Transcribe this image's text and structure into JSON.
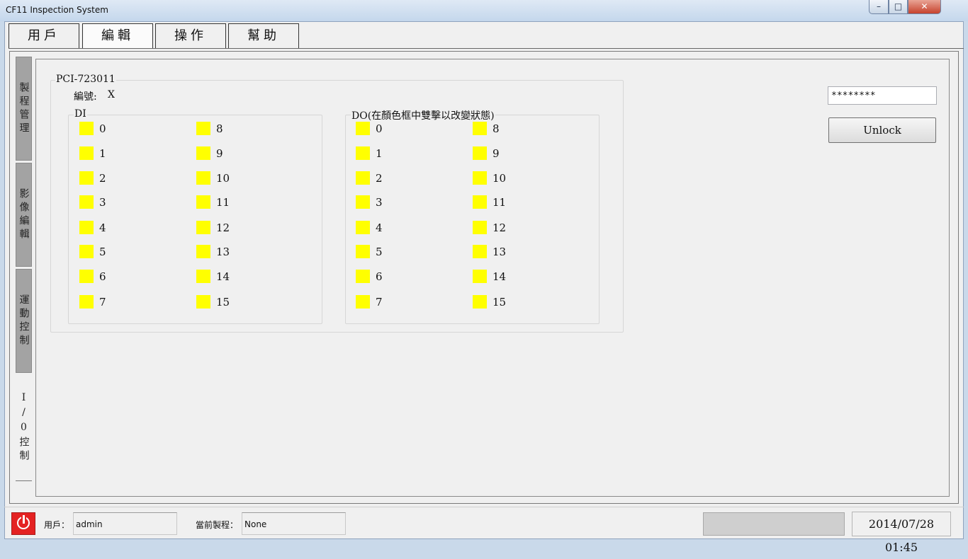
{
  "window": {
    "title": "CF11 Inspection System",
    "controls": {
      "min": "–",
      "max": "□",
      "close": "✕"
    }
  },
  "menu": [
    {
      "label": "用戶"
    },
    {
      "label": "編輯"
    },
    {
      "label": "操作"
    },
    {
      "label": "幫助"
    }
  ],
  "side_tabs": [
    {
      "label": "製程管理"
    },
    {
      "label": "影像編輯"
    },
    {
      "label": "運動控制"
    },
    {
      "label": "I/0控制"
    }
  ],
  "io": {
    "card": "PCI-723011",
    "id_label": "編號:",
    "id_value": "X",
    "di": {
      "title": "DI",
      "channels": [
        "0",
        "1",
        "2",
        "3",
        "4",
        "5",
        "6",
        "7",
        "8",
        "9",
        "10",
        "11",
        "12",
        "13",
        "14",
        "15"
      ],
      "indicator_color": "#ffff00"
    },
    "do": {
      "title": "DO(在顏色框中雙擊以改變狀態)",
      "channels": [
        "0",
        "1",
        "2",
        "3",
        "4",
        "5",
        "6",
        "7",
        "8",
        "9",
        "10",
        "11",
        "12",
        "13",
        "14",
        "15"
      ],
      "indicator_color": "#ffff00"
    }
  },
  "lock": {
    "password_value": "********",
    "unlock_label": "Unlock"
  },
  "status": {
    "user_label": "用戶：",
    "user_value": "admin",
    "process_label": "當前製程：",
    "process_value": "None",
    "progress_percent": 0,
    "datetime": "2014/07/28 01:45",
    "power_icon_color": "#e42222"
  }
}
